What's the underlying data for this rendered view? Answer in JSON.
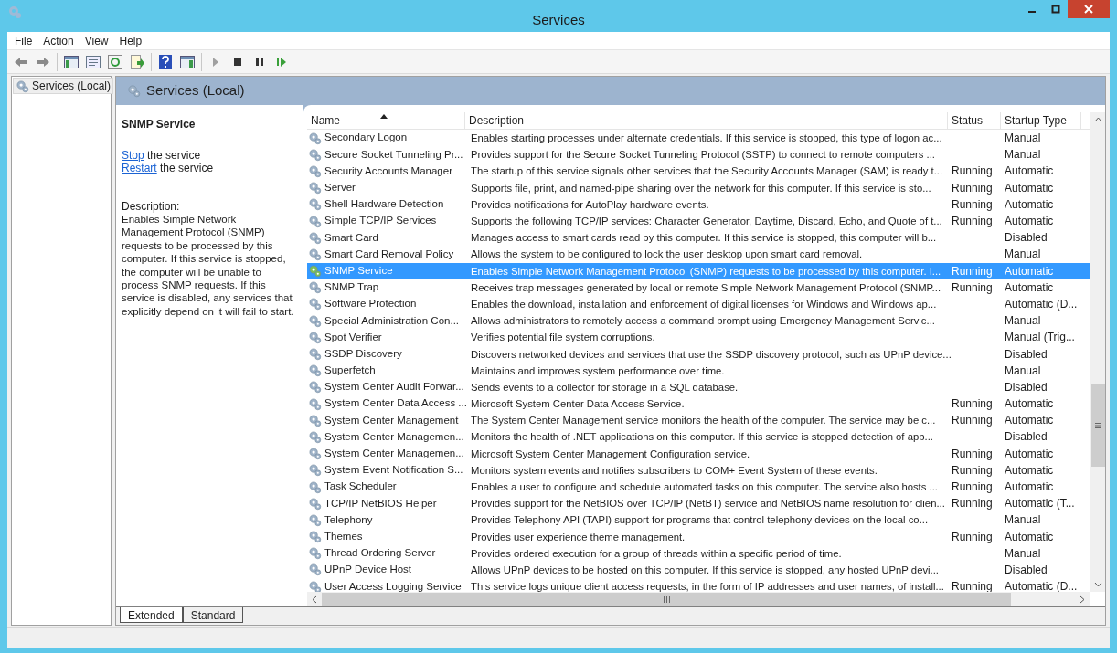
{
  "window": {
    "title": "Services"
  },
  "menu": [
    "File",
    "Action",
    "View",
    "Help"
  ],
  "tree": {
    "items": [
      {
        "label": "Services (Local)",
        "selected": true
      }
    ]
  },
  "pane_title": "Services (Local)",
  "details": {
    "title": "SNMP Service",
    "actions": [
      {
        "link": "Stop",
        "text": "the service"
      },
      {
        "link": "Restart",
        "text": "the service"
      }
    ],
    "description_label": "Description:",
    "description": "Enables Simple Network Management Protocol (SNMP) requests to be processed by this computer. If this service is stopped, the computer will be unable to process SNMP requests. If this service is disabled, any services that explicitly depend on it will fail to start."
  },
  "table": {
    "columns": [
      "Name",
      "Description",
      "Status",
      "Startup Type"
    ],
    "rows": [
      {
        "name": "Secondary Logon",
        "description": "Enables starting processes under alternate credentials. If this service is stopped, this type of logon ac...",
        "status": "",
        "startup": "Manual",
        "selected": false
      },
      {
        "name": "Secure Socket Tunneling Pr...",
        "description": "Provides support for the Secure Socket Tunneling Protocol (SSTP) to connect to remote computers ...",
        "status": "",
        "startup": "Manual",
        "selected": false
      },
      {
        "name": "Security Accounts Manager",
        "description": "The startup of this service signals other services that the Security Accounts Manager (SAM) is ready t...",
        "status": "Running",
        "startup": "Automatic",
        "selected": false
      },
      {
        "name": "Server",
        "description": "Supports file, print, and named-pipe sharing over the network for this computer. If this service is sto...",
        "status": "Running",
        "startup": "Automatic",
        "selected": false
      },
      {
        "name": "Shell Hardware Detection",
        "description": "Provides notifications for AutoPlay hardware events.",
        "status": "Running",
        "startup": "Automatic",
        "selected": false
      },
      {
        "name": "Simple TCP/IP Services",
        "description": "Supports the following TCP/IP services: Character Generator, Daytime, Discard, Echo, and Quote of t...",
        "status": "Running",
        "startup": "Automatic",
        "selected": false
      },
      {
        "name": "Smart Card",
        "description": "Manages access to smart cards read by this computer. If this service is stopped, this computer will b...",
        "status": "",
        "startup": "Disabled",
        "selected": false
      },
      {
        "name": "Smart Card Removal Policy",
        "description": "Allows the system to be configured to lock the user desktop upon smart card removal.",
        "status": "",
        "startup": "Manual",
        "selected": false
      },
      {
        "name": "SNMP Service",
        "description": "Enables Simple Network Management Protocol (SNMP) requests to be processed by this computer. I...",
        "status": "Running",
        "startup": "Automatic",
        "selected": true
      },
      {
        "name": "SNMP Trap",
        "description": "Receives trap messages generated by local or remote Simple Network Management Protocol (SNMP...",
        "status": "Running",
        "startup": "Automatic",
        "selected": false
      },
      {
        "name": "Software Protection",
        "description": "Enables the download, installation and enforcement of digital licenses for Windows and Windows ap...",
        "status": "",
        "startup": "Automatic (D...",
        "selected": false
      },
      {
        "name": "Special Administration Con...",
        "description": "Allows administrators to remotely access a command prompt using Emergency Management Servic...",
        "status": "",
        "startup": "Manual",
        "selected": false
      },
      {
        "name": "Spot Verifier",
        "description": "Verifies potential file system corruptions.",
        "status": "",
        "startup": "Manual (Trig...",
        "selected": false
      },
      {
        "name": "SSDP Discovery",
        "description": "Discovers networked devices and services that use the SSDP discovery protocol, such as UPnP device...",
        "status": "",
        "startup": "Disabled",
        "selected": false
      },
      {
        "name": "Superfetch",
        "description": "Maintains and improves system performance over time.",
        "status": "",
        "startup": "Manual",
        "selected": false
      },
      {
        "name": "System Center Audit Forwar...",
        "description": "Sends events to a collector for storage in a SQL database.",
        "status": "",
        "startup": "Disabled",
        "selected": false
      },
      {
        "name": "System Center Data Access ...",
        "description": "Microsoft System Center Data Access Service.",
        "status": "Running",
        "startup": "Automatic",
        "selected": false
      },
      {
        "name": "System Center Management",
        "description": "The System Center Management service monitors the health of the computer. The service may be c...",
        "status": "Running",
        "startup": "Automatic",
        "selected": false
      },
      {
        "name": "System Center Managemen...",
        "description": "Monitors the health of .NET applications on this computer. If this service is stopped detection of app...",
        "status": "",
        "startup": "Disabled",
        "selected": false
      },
      {
        "name": "System Center Managemen...",
        "description": "Microsoft System Center Management Configuration service.",
        "status": "Running",
        "startup": "Automatic",
        "selected": false
      },
      {
        "name": "System Event Notification S...",
        "description": "Monitors system events and notifies subscribers to COM+ Event System of these events.",
        "status": "Running",
        "startup": "Automatic",
        "selected": false
      },
      {
        "name": "Task Scheduler",
        "description": "Enables a user to configure and schedule automated tasks on this computer. The service also hosts ...",
        "status": "Running",
        "startup": "Automatic",
        "selected": false
      },
      {
        "name": "TCP/IP NetBIOS Helper",
        "description": "Provides support for the NetBIOS over TCP/IP (NetBT) service and NetBIOS name resolution for clien...",
        "status": "Running",
        "startup": "Automatic (T...",
        "selected": false
      },
      {
        "name": "Telephony",
        "description": "Provides Telephony API (TAPI) support for programs that control telephony devices on the local co...",
        "status": "",
        "startup": "Manual",
        "selected": false
      },
      {
        "name": "Themes",
        "description": "Provides user experience theme management.",
        "status": "Running",
        "startup": "Automatic",
        "selected": false
      },
      {
        "name": "Thread Ordering Server",
        "description": "Provides ordered execution for a group of threads within a specific period of time.",
        "status": "",
        "startup": "Manual",
        "selected": false
      },
      {
        "name": "UPnP Device Host",
        "description": "Allows UPnP devices to be hosted on this computer. If this service is stopped, any hosted UPnP devi...",
        "status": "",
        "startup": "Disabled",
        "selected": false
      },
      {
        "name": "User Access Logging Service",
        "description": "This service logs unique client access requests, in the form of IP addresses and user names, of install...",
        "status": "Running",
        "startup": "Automatic (D...",
        "selected": false
      }
    ]
  },
  "tabs": [
    {
      "label": "Extended",
      "selected": true
    },
    {
      "label": "Standard",
      "selected": false
    }
  ]
}
